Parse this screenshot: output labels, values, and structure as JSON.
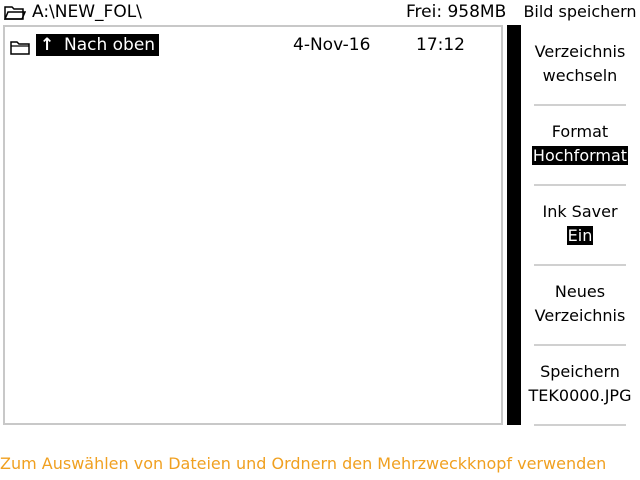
{
  "header": {
    "path": "A:\\NEW_FOL\\",
    "free_space": "Frei: 958MB",
    "icon": "folder-open-icon"
  },
  "file_list": {
    "rows": [
      {
        "icon": "folder-icon",
        "arrow": "🠉",
        "name": "Nach oben",
        "date": "4-Nov-16",
        "time": "17:12",
        "selected": true
      }
    ]
  },
  "side_menu": {
    "title": "Bild speichern",
    "items": [
      {
        "line1": "Verzeichnis",
        "line2": "wechseln"
      },
      {
        "line1": "Format",
        "value": "Hochformat"
      },
      {
        "line1": "Ink Saver",
        "value": "Ein"
      },
      {
        "line1": "Neues",
        "line2": "Verzeichnis"
      },
      {
        "line1": "Speichern",
        "line2": "TEK0000.JPG"
      }
    ]
  },
  "status": {
    "hint": "Zum Auswählen von Dateien und Ordnern den Mehrzweckknopf verwenden",
    "hint_color": "#f0a020"
  },
  "colors": {
    "selection_bg": "#000000",
    "selection_fg": "#ffffff",
    "border": "#c8c8c8"
  }
}
